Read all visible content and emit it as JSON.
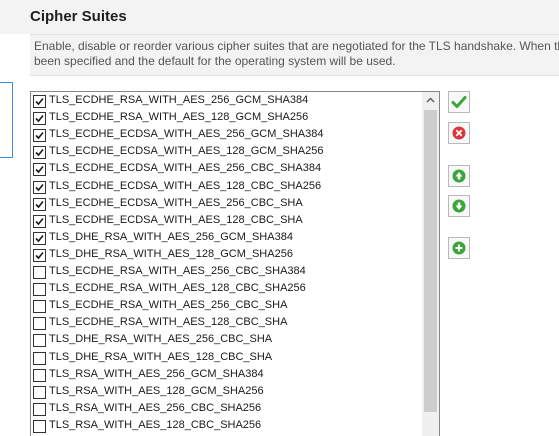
{
  "section": {
    "title": "Cipher Suites",
    "description_line1": "Enable, disable or reorder various cipher suites that are negotiated for the TLS handshake. When the",
    "description_line2": "been specified and the default for the operating system will be used."
  },
  "cipher_suites": [
    {
      "label": "TLS_ECDHE_RSA_WITH_AES_256_GCM_SHA384",
      "checked": true
    },
    {
      "label": "TLS_ECDHE_RSA_WITH_AES_128_GCM_SHA256",
      "checked": true
    },
    {
      "label": "TLS_ECDHE_ECDSA_WITH_AES_256_GCM_SHA384",
      "checked": true
    },
    {
      "label": "TLS_ECDHE_ECDSA_WITH_AES_128_GCM_SHA256",
      "checked": true
    },
    {
      "label": "TLS_ECDHE_ECDSA_WITH_AES_256_CBC_SHA384",
      "checked": true
    },
    {
      "label": "TLS_ECDHE_ECDSA_WITH_AES_128_CBC_SHA256",
      "checked": true
    },
    {
      "label": "TLS_ECDHE_ECDSA_WITH_AES_256_CBC_SHA",
      "checked": true
    },
    {
      "label": "TLS_ECDHE_ECDSA_WITH_AES_128_CBC_SHA",
      "checked": true
    },
    {
      "label": "TLS_DHE_RSA_WITH_AES_256_GCM_SHA384",
      "checked": true
    },
    {
      "label": "TLS_DHE_RSA_WITH_AES_128_GCM_SHA256",
      "checked": true
    },
    {
      "label": "TLS_ECDHE_RSA_WITH_AES_256_CBC_SHA384",
      "checked": false
    },
    {
      "label": "TLS_ECDHE_RSA_WITH_AES_128_CBC_SHA256",
      "checked": false
    },
    {
      "label": "TLS_ECDHE_RSA_WITH_AES_256_CBC_SHA",
      "checked": false
    },
    {
      "label": "TLS_ECDHE_RSA_WITH_AES_128_CBC_SHA",
      "checked": false
    },
    {
      "label": "TLS_DHE_RSA_WITH_AES_256_CBC_SHA",
      "checked": false
    },
    {
      "label": "TLS_DHE_RSA_WITH_AES_128_CBC_SHA",
      "checked": false
    },
    {
      "label": "TLS_RSA_WITH_AES_256_GCM_SHA384",
      "checked": false
    },
    {
      "label": "TLS_RSA_WITH_AES_128_GCM_SHA256",
      "checked": false
    },
    {
      "label": "TLS_RSA_WITH_AES_256_CBC_SHA256",
      "checked": false
    },
    {
      "label": "TLS_RSA_WITH_AES_128_CBC_SHA256",
      "checked": false
    }
  ],
  "side_buttons": [
    {
      "name": "enable-button",
      "icon": "checkmark-icon",
      "color": "#3aa53a"
    },
    {
      "name": "disable-button",
      "icon": "red-x-icon",
      "color": "#d9363e"
    },
    {
      "name": "move-up-button",
      "icon": "up-arrow-icon",
      "color": "#3aa53a"
    },
    {
      "name": "move-down-button",
      "icon": "down-arrow-icon",
      "color": "#3aa53a"
    },
    {
      "name": "reset-default-button",
      "icon": "green-plus-icon",
      "color": "#3aa53a"
    }
  ],
  "colors": {
    "accent_blue": "#3d8ee0",
    "check_green": "#3aa53a",
    "remove_red": "#d9363e"
  }
}
